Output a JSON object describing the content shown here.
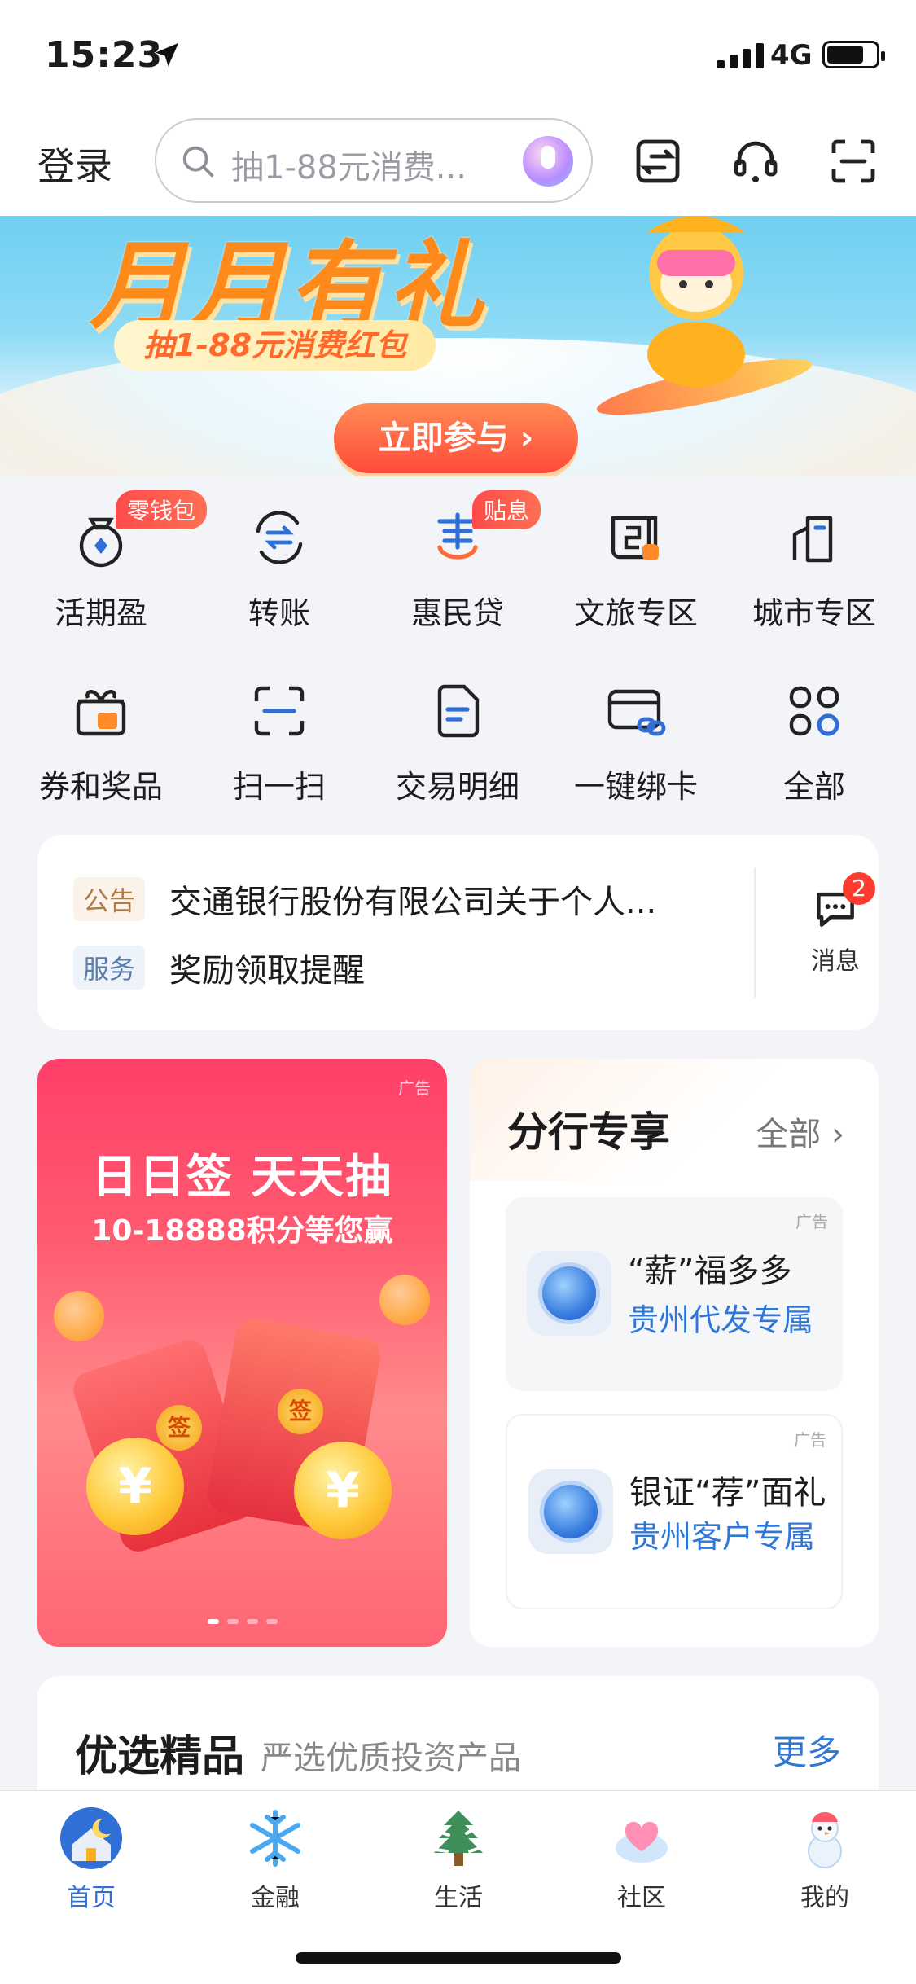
{
  "status_bar": {
    "time": "15:23",
    "network": "4G"
  },
  "header": {
    "login_label": "登录",
    "search_placeholder": "抽1-88元消费..."
  },
  "banner": {
    "title": "月月有礼",
    "subtitle": "抽1-88元消费红包",
    "cta_label": "立即参与 ›"
  },
  "quick_actions": [
    {
      "label": "活期盈",
      "badge": "零钱包",
      "icon": "wallet-bag-icon"
    },
    {
      "label": "转账",
      "badge": "",
      "icon": "transfer-icon"
    },
    {
      "label": "惠民贷",
      "badge": "贴息",
      "icon": "loan-icon"
    },
    {
      "label": "文旅专区",
      "badge": "",
      "icon": "travel-icon"
    },
    {
      "label": "城市专区",
      "badge": "",
      "icon": "city-icon"
    },
    {
      "label": "券和奖品",
      "badge": "",
      "icon": "gift-icon"
    },
    {
      "label": "扫一扫",
      "badge": "",
      "icon": "scan-icon"
    },
    {
      "label": "交易明细",
      "badge": "",
      "icon": "document-icon"
    },
    {
      "label": "一键绑卡",
      "badge": "",
      "icon": "bind-card-icon"
    },
    {
      "label": "全部",
      "badge": "",
      "icon": "all-apps-icon"
    }
  ],
  "notices": [
    {
      "tag": "公告",
      "text": "交通银行股份有限公司关于个人..."
    },
    {
      "tag": "服务",
      "text": "奖励领取提醒"
    }
  ],
  "messages": {
    "label": "消息",
    "count": "2"
  },
  "promo": {
    "ad_label": "广告",
    "headline": "日日签  天天抽",
    "subline": "10-18888积分等您赢",
    "seal_char": "签",
    "coin_char": "¥"
  },
  "branch": {
    "title": "分行专享",
    "all_label": "全部 ›",
    "items": [
      {
        "ad_label": "广告",
        "line1": "“薪”福多多",
        "line2": "贵州代发专属"
      },
      {
        "ad_label": "广告",
        "line1": "银证“荐”面礼",
        "line2": "贵州客户专属"
      }
    ]
  },
  "featured": {
    "title": "优选精品",
    "subtitle": "严选优质投资产品",
    "more_label": "更多"
  },
  "tabs": [
    {
      "label": "首页",
      "active": true
    },
    {
      "label": "金融",
      "active": false
    },
    {
      "label": "生活",
      "active": false
    },
    {
      "label": "社区",
      "active": false
    },
    {
      "label": "我的",
      "active": false
    }
  ],
  "colors": {
    "accent": "#2f6fd6",
    "badge": "#ff4b4b",
    "promo": "#ff4d6d",
    "link": "#2f77d6"
  }
}
